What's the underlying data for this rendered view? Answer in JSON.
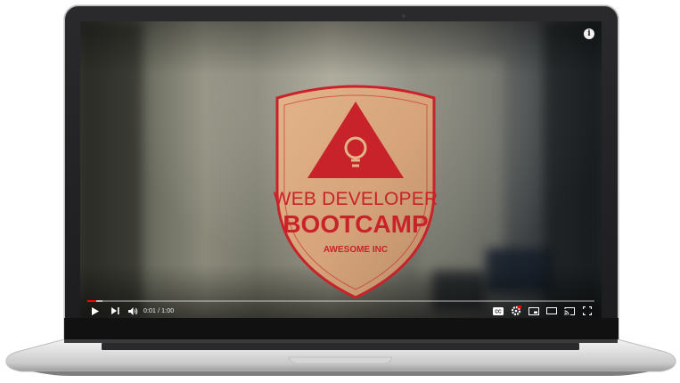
{
  "player": {
    "current_time": "0:01",
    "separator": " / ",
    "duration": "1:00",
    "progress_fraction": 0.017,
    "buffered_fraction": 0.03,
    "info_glyph": "i"
  },
  "logo": {
    "line1": "WEB DEVELOPER",
    "line2": "BOOTCAMP",
    "line3": "AWESOME INC"
  },
  "controls": {
    "captions_label": "CC"
  },
  "colors": {
    "brand_red": "#c8232b",
    "shield_fill": "#d9a87c",
    "progress_red": "#ff0000"
  },
  "icons": [
    "play-icon",
    "next-icon",
    "volume-icon",
    "captions-icon",
    "settings-icon",
    "miniplayer-icon",
    "theater-icon",
    "cast-icon",
    "fullscreen-icon",
    "info-icon",
    "lightbulb-icon"
  ]
}
